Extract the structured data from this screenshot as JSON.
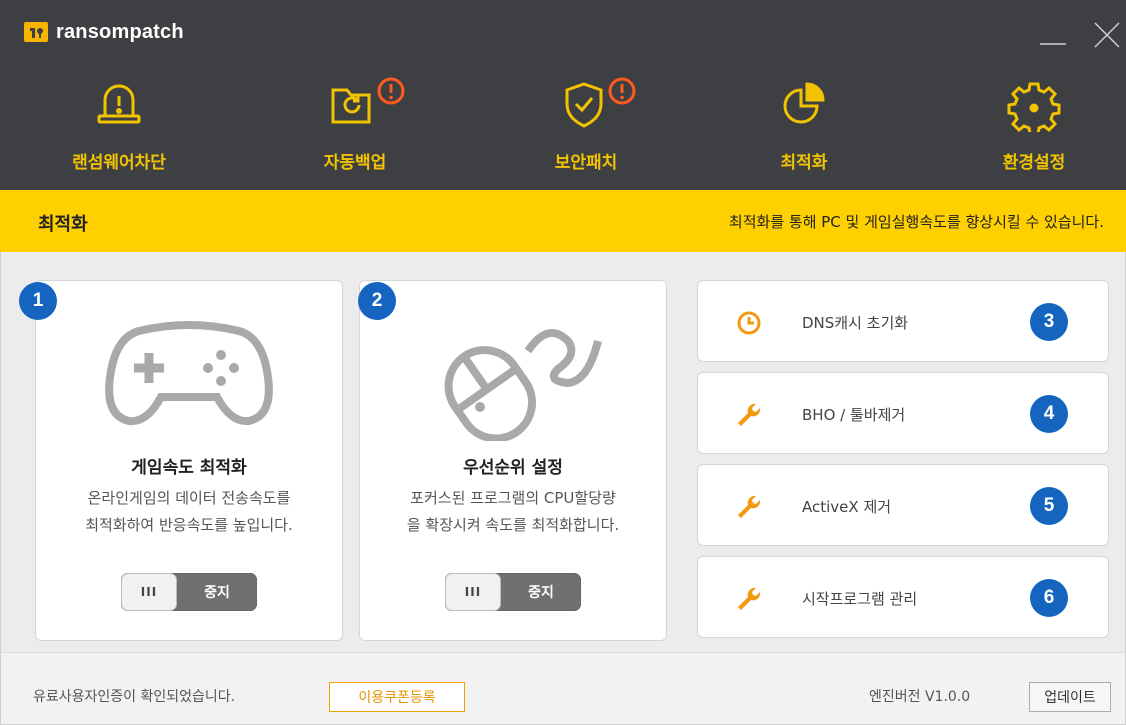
{
  "app": {
    "logo_text": "ransompatch"
  },
  "nav": {
    "items": [
      {
        "label": "랜섬웨어차단",
        "icon": "alarm-icon"
      },
      {
        "label": "자동백업",
        "icon": "folder-refresh-icon",
        "alert": "!"
      },
      {
        "label": "보안패치",
        "icon": "shield-check-icon",
        "alert": "!"
      },
      {
        "label": "최적화",
        "icon": "pie-chart-icon"
      },
      {
        "label": "환경설정",
        "icon": "gear-icon"
      }
    ]
  },
  "titlebar": {
    "title": "최적화",
    "description": "최적화를 통해 PC 및 게임실행속도를 향상시킬 수 있습니다."
  },
  "cards": [
    {
      "badge": "1",
      "icon": "gamepad-icon",
      "title": "게임속도 최적화",
      "desc_line1": "온라인게임의 데이터 전송속도를",
      "desc_line2": "최적화하여 반응속도를 높입니다.",
      "toggle_knob": "III",
      "toggle_label": "중지"
    },
    {
      "badge": "2",
      "icon": "mouse-icon",
      "title": "우선순위 설정",
      "desc_line1": "포커스된 프로그램의 CPU할당량",
      "desc_line2": "을 확장시켜 속도를 최적화합니다.",
      "toggle_knob": "III",
      "toggle_label": "중지"
    }
  ],
  "actions": [
    {
      "badge": "3",
      "label": "DNS캐시 초기화",
      "icon": "timer-icon"
    },
    {
      "badge": "4",
      "label": "BHO / 툴바제거",
      "icon": "wrench-icon"
    },
    {
      "badge": "5",
      "label": "ActiveX 제거",
      "icon": "wrench-icon"
    },
    {
      "badge": "6",
      "label": "시작프로그램 관리",
      "icon": "wrench-icon"
    }
  ],
  "footer": {
    "status": "유료사용자인증이 확인되었습니다.",
    "coupon_button": "이용쿠폰등록",
    "engine_version": "엔진버전 V1.0.0",
    "update_button": "업데이트"
  },
  "colors": {
    "header_bg": "#3d3f42",
    "accent_yellow": "#ffd000",
    "icon_yellow": "#f2c300",
    "alert_orange": "#ff5a1f",
    "action_orange": "#f39a12",
    "badge_blue": "#1565c0"
  }
}
